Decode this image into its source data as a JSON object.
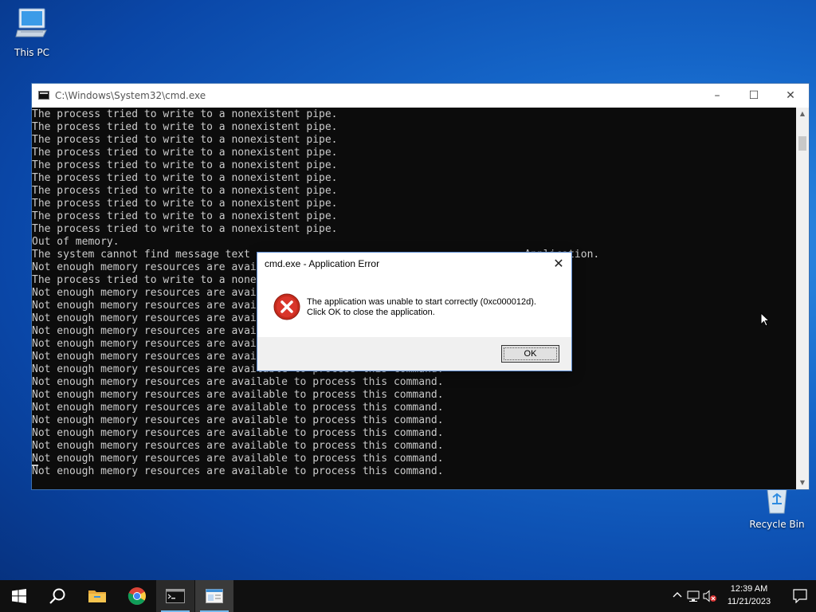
{
  "desktop": {
    "icons": [
      {
        "label": "This PC",
        "icon": "computer-icon"
      },
      {
        "label": "Recycle Bin",
        "icon": "recycle-bin-icon"
      }
    ]
  },
  "cmd_window": {
    "title": "C:\\Windows\\System32\\cmd.exe",
    "icon": "console-app-icon",
    "controls": {
      "minimize": "–",
      "maximize": "☐",
      "close": "✕"
    },
    "lines": [
      "The process tried to write to a nonexistent pipe.",
      "The process tried to write to a nonexistent pipe.",
      "The process tried to write to a nonexistent pipe.",
      "The process tried to write to a nonexistent pipe.",
      "The process tried to write to a nonexistent pipe.",
      "The process tried to write to a nonexistent pipe.",
      "The process tried to write to a nonexistent pipe.",
      "The process tried to write to a nonexistent pipe.",
      "The process tried to write to a nonexistent pipe.",
      "The process tried to write to a nonexistent pipe.",
      "Out of memory.",
      "The system cannot find message text                                            Application.",
      "Not enough memory resources are avai",
      "The process tried to write to a none",
      "Not enough memory resources are avai",
      "Not enough memory resources are avai",
      "Not enough memory resources are avai",
      "Not enough memory resources are avai",
      "Not enough memory resources are avai",
      "Not enough memory resources are avai",
      "Not enough memory resources are available to process this command.",
      "Not enough memory resources are available to process this command.",
      "Not enough memory resources are available to process this command.",
      "Not enough memory resources are available to process this command.",
      "Not enough memory resources are available to process this command.",
      "Not enough memory resources are available to process this command.",
      "Not enough memory resources are available to process this command.",
      "Not enough memory resources are available to process this command.",
      "Not enough memory resources are available to process this command.",
      ""
    ]
  },
  "error_dialog": {
    "title": "cmd.exe - Application Error",
    "close": "✕",
    "icon": "error-icon",
    "message_line1": "The application was unable to start correctly (0xc000012d).",
    "message_line2": "Click OK to close the application.",
    "ok_label": "OK"
  },
  "taskbar": {
    "items": [
      "start-icon",
      "search-icon",
      "file-explorer-icon",
      "chrome-icon",
      "cmd-icon",
      "app-window-icon"
    ],
    "tray": {
      "icons": [
        "chevron-up-icon",
        "network-icon",
        "volume-muted-icon"
      ]
    },
    "clock": {
      "time": "12:39 AM",
      "date": "11/21/2023"
    },
    "notification_icon": "notification-icon"
  },
  "colors": {
    "console_bg": "#0c0c0c",
    "console_text": "#cccccc",
    "error_red": "#c42b1c",
    "taskbar_bg": "#101010",
    "accent": "#76b9ed"
  }
}
